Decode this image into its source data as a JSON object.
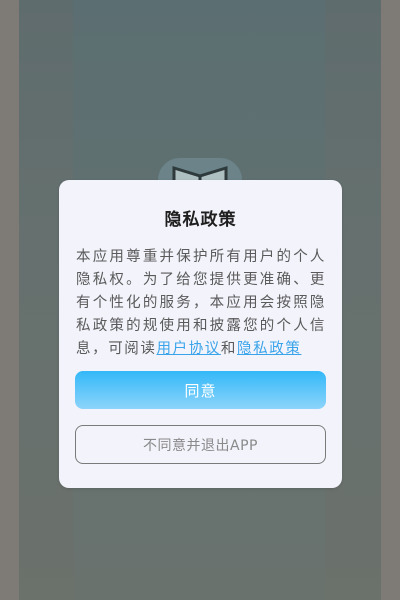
{
  "dialog": {
    "title": "隐私政策",
    "body_text": "本应用尊重并保护所有用户的个人隐私权。为了给您提供更准确、更有个性化的服务，本应用会按照隐私政策的规使用和披露您的个人信息，可阅读",
    "link_user_agreement": "用户协议",
    "conjunction": "和",
    "link_privacy_policy": "隐私政策",
    "agree_label": "同意",
    "disagree_label": "不同意并退出APP"
  },
  "colors": {
    "accent": "#3aa4ea",
    "agree_gradient_top": "#33b8f8",
    "agree_gradient_bottom": "#8dd4fb",
    "dialog_background": "#f2f3fb",
    "scrim": "#7e7b77"
  },
  "icons": {
    "background_app_icon": "book-icon"
  }
}
